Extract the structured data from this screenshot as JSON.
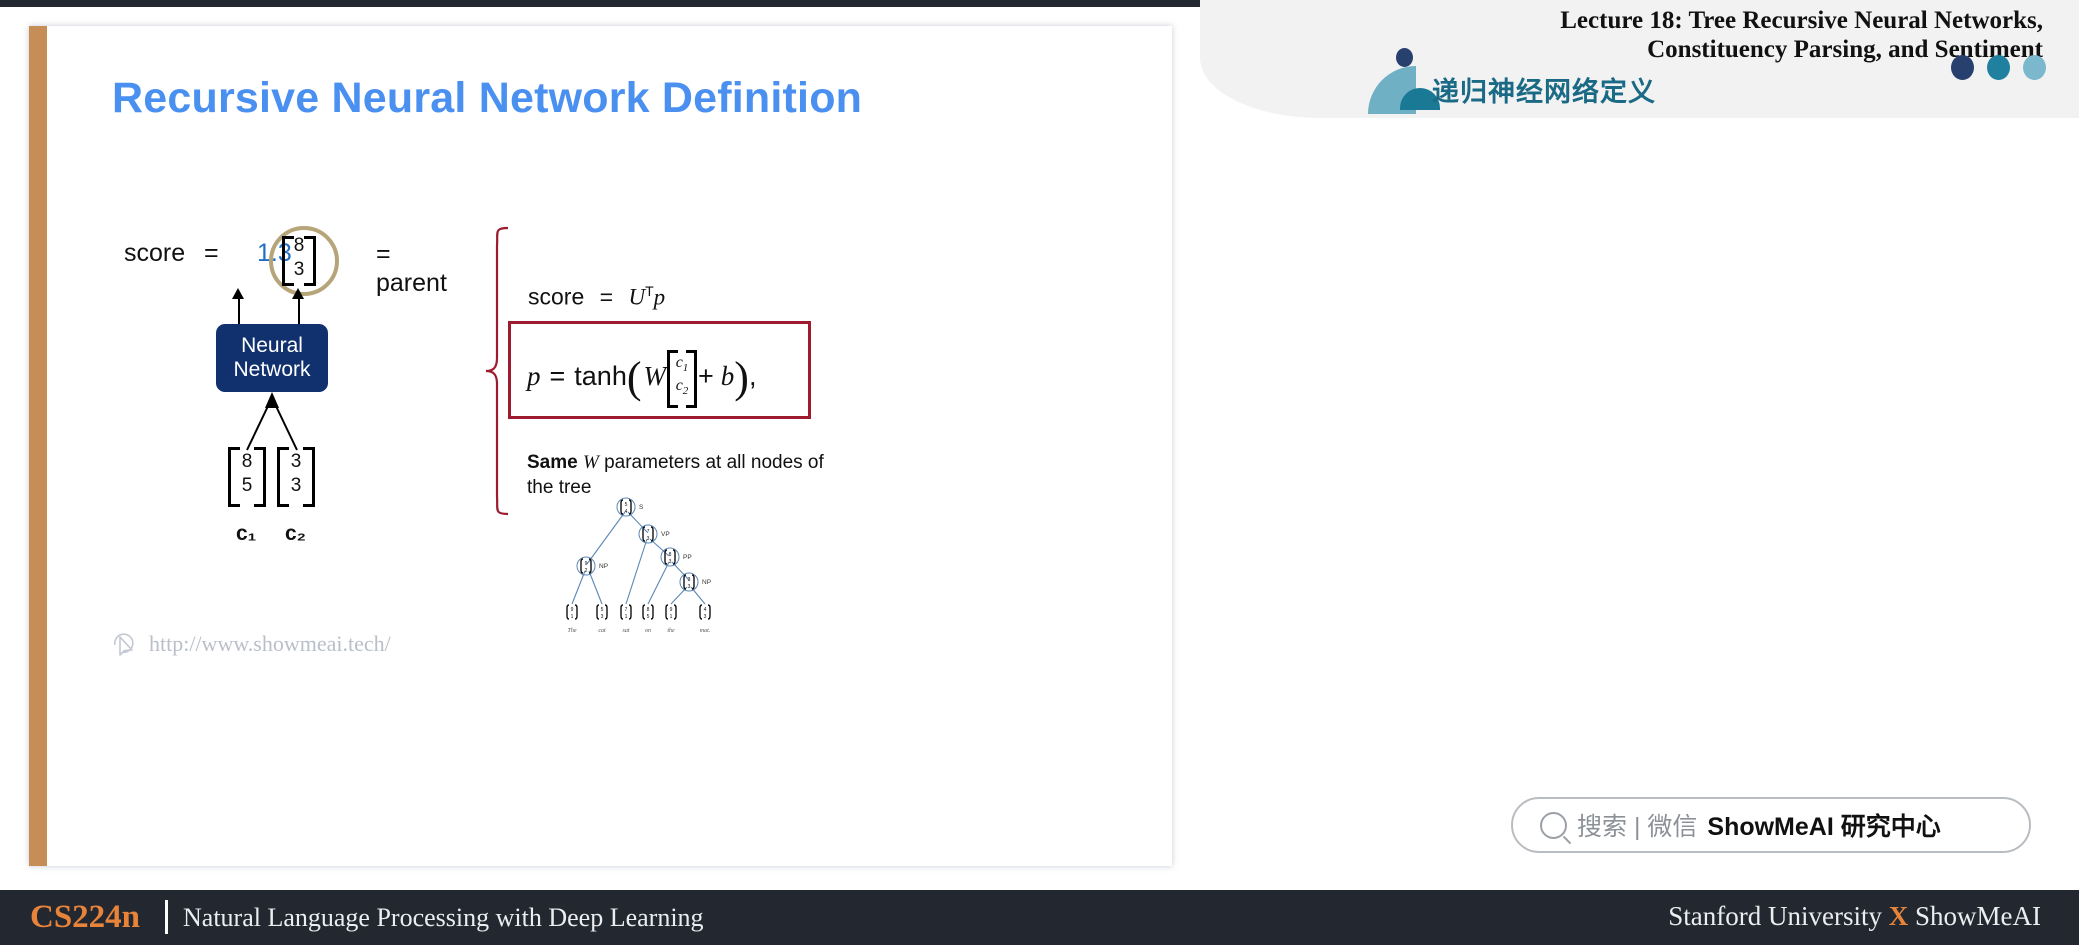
{
  "header": {
    "lecture_line1": "Lecture 18: Tree Recursive Neural Networks,",
    "lecture_line2": "Constituency Parsing, and Sentiment",
    "chinese_subtitle": "递归神经网络定义",
    "dots": [
      "#28406e",
      "#2080a0",
      "#7bb8ce"
    ]
  },
  "slide": {
    "title": "Recursive Neural Network Definition",
    "accent_bar_color": "#c68e56",
    "title_color": "#4a90f0",
    "watermark": "http://www.showmeai.tech/",
    "diagram": {
      "score_label": "score",
      "equals": "=",
      "score_value": "1.3",
      "score_value_color": "#1f6fc4",
      "parent_label": "= parent",
      "parent_vector": [
        "8",
        "3"
      ],
      "nn_box_line1": "Neural",
      "nn_box_line2": "Network",
      "nn_box_color": "#10306e",
      "child1_vector": [
        "8",
        "5"
      ],
      "child2_vector": [
        "3",
        "3"
      ],
      "child1_label": "c₁",
      "child2_label": "c₂"
    },
    "equations": {
      "score_eq_label": "score",
      "score_eq_equals": "=",
      "score_eq_rhs_U": "U",
      "score_eq_rhs_T": "T",
      "score_eq_rhs_p": "p",
      "p_label": "p",
      "p_equals": "=",
      "p_tanh": "tanh",
      "p_open": "(",
      "p_W": "W",
      "p_c1": "c",
      "p_c1_sub": "1",
      "p_c2": "c",
      "p_c2_sub": "2",
      "p_plus": "+",
      "p_b": "b",
      "p_close": ")",
      "p_comma": ",",
      "box_border_color": "#9e1b2f",
      "note_bold": "Same",
      "note_italic": "W",
      "note_rest": " parameters at all nodes of the tree"
    },
    "parse_tree": {
      "node_labels": [
        "S",
        "VP",
        "PP",
        "NP",
        "NP"
      ],
      "leaf_words": [
        "The",
        "cat",
        "sat",
        "on",
        "the",
        "mat."
      ],
      "leaf_vectors": [
        [
          "9",
          "1"
        ],
        [
          "5",
          "3"
        ],
        [
          "7",
          "1"
        ],
        [
          "8",
          "5"
        ],
        [
          "9",
          "1"
        ],
        [
          "4",
          "3"
        ]
      ],
      "internal_vectors": [
        [
          "5",
          "4"
        ],
        [
          "7",
          "3"
        ],
        [
          "8",
          "3"
        ],
        [
          "9",
          "2"
        ],
        [
          "3",
          "3"
        ]
      ],
      "edge_color": "#5b87b5"
    }
  },
  "search": {
    "icon": "search-icon",
    "grey_text": "搜索 | 微信",
    "bold_text": "ShowMeAI 研究中心"
  },
  "footer": {
    "course_code": "CS224n",
    "course_name": "Natural Language Processing with Deep Learning",
    "right_pre": "Stanford University ",
    "right_x": "X",
    "right_post": " ShowMeAI",
    "bg": "#23272f",
    "accent": "#e8833a"
  }
}
